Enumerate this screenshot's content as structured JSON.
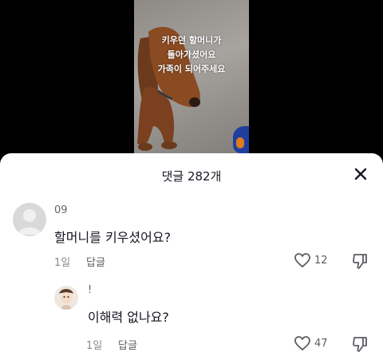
{
  "video": {
    "caption_lines": [
      "키우던 할머니가",
      "돌아가셨어요",
      "가족이 되어주세요"
    ]
  },
  "comments_sheet": {
    "title": "댓글 282개",
    "comments": [
      {
        "username": "09",
        "text": "할머니를 키우셨어요?",
        "time": "1일",
        "reply_label": "답글",
        "likes": "12"
      },
      {
        "username": "!",
        "text": "이해력 없나요?",
        "time": "1일",
        "reply_label": "답글",
        "likes": "47"
      }
    ]
  },
  "icons": {
    "close": "close-icon",
    "like": "heart-outline-icon",
    "dislike": "thumbs-down-icon"
  },
  "colors": {
    "sheet_bg": "#ffffff",
    "text_primary": "#161823",
    "text_secondary": "#8a8b91"
  }
}
